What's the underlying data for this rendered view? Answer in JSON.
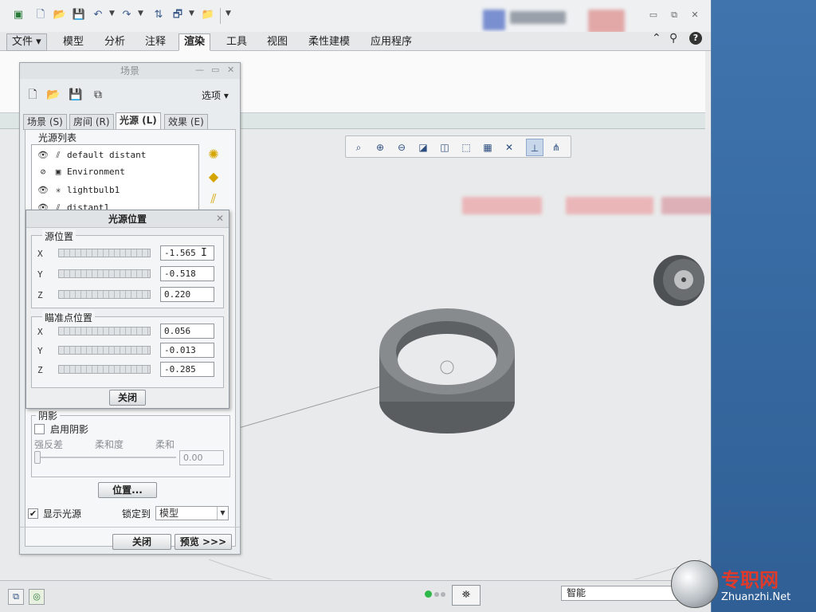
{
  "quick_access": {
    "icons": [
      "app-icon",
      "new-icon",
      "open-icon",
      "save-icon",
      "undo-icon",
      "redo-icon",
      "regenerate-icon",
      "windows-icon",
      "folder-icon",
      "customize-icon"
    ]
  },
  "ribbon": {
    "tabs": [
      "文件",
      "模型",
      "分析",
      "注释",
      "渲染",
      "工具",
      "视图",
      "柔性建模",
      "应用程序"
    ],
    "active_tab": "渲染"
  },
  "graphics_toolbar": {
    "icons": [
      "refit-icon",
      "zoom-in-icon",
      "zoom-out-icon",
      "repaint-icon",
      "display-style-icon",
      "saved-views-icon",
      "view-manager-icon",
      "perspective-icon",
      "datum-display-icon",
      "spin-center-icon",
      "annotation-display-icon"
    ]
  },
  "scene_dialog": {
    "title": "场景",
    "options_label": "选项",
    "tabs": [
      "场景 (S)",
      "房间 (R)",
      "光源 (L)",
      "效果 (E)"
    ],
    "active_tab": "光源 (L)",
    "light_list_label": "光源列表",
    "lights": [
      {
        "name": "default distant",
        "icon": "distant-light-icon",
        "visible": true
      },
      {
        "name": "Environment",
        "icon": "environment-light-icon",
        "visible": false
      },
      {
        "name": "lightbulb1",
        "icon": "bulb-light-icon",
        "visible": true
      },
      {
        "name": "distant1",
        "icon": "distant-light-icon",
        "visible": true
      }
    ],
    "shadow": {
      "label": "阴影",
      "enable_label": "启用阴影",
      "enabled": false,
      "contrast_label": "强反差",
      "softness_label": "柔和度",
      "soft_label": "柔和",
      "value": "0.00"
    },
    "position_button": "位置...",
    "show_lights_label": "显示光源",
    "show_lights_checked": true,
    "lock_to_label": "锁定到",
    "lock_to_value": "模型",
    "close_button": "关闭",
    "preview_button": "预览 >>>"
  },
  "light_position": {
    "title": "光源位置",
    "source_label": "源位置",
    "aim_label": "瞄准点位置",
    "source": [
      {
        "axis": "X",
        "value": "-1.565"
      },
      {
        "axis": "Y",
        "value": "-0.518"
      },
      {
        "axis": "Z",
        "value": "0.220"
      }
    ],
    "aim": [
      {
        "axis": "X",
        "value": "0.056"
      },
      {
        "axis": "Y",
        "value": "-0.013"
      },
      {
        "axis": "Z",
        "value": "-0.285"
      }
    ],
    "close_button": "关闭"
  },
  "status_bar": {
    "filter_value": "智能"
  },
  "watermark": {
    "cn": "专职网",
    "en": "Zhuanzhi.Net"
  }
}
